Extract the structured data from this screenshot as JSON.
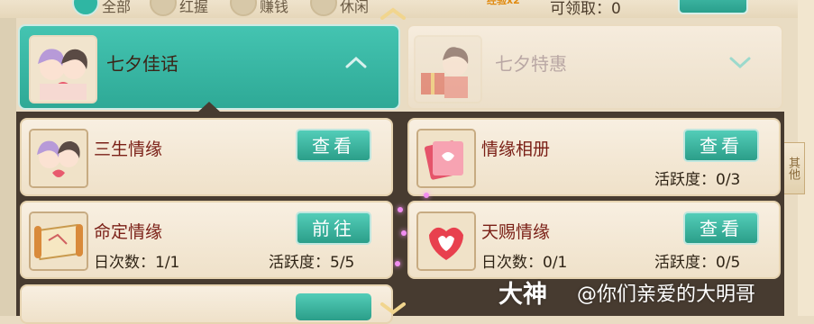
{
  "filter_bar": {
    "options": [
      {
        "label": "全部",
        "selected": true
      },
      {
        "label": "红握",
        "selected": false
      },
      {
        "label": "赚钱",
        "selected": false
      },
      {
        "label": "休闲",
        "selected": false
      }
    ],
    "exp_badge": "经验x2",
    "claim_text": "可领取：0"
  },
  "tabs": [
    {
      "label": "七夕佳话",
      "active": true,
      "icon": "couple-portrait-icon"
    },
    {
      "label": "七夕特惠",
      "active": false,
      "icon": "gift-girl-portrait-icon"
    }
  ],
  "side_tab": {
    "label": "其他"
  },
  "cards": [
    {
      "title": "三生情缘",
      "button": "查看",
      "icon": "couple-portrait-icon",
      "daily": "",
      "activity": ""
    },
    {
      "title": "情缘相册",
      "button": "查看",
      "icon": "photo-album-icon",
      "daily": "",
      "activity": "活跃度：0/3"
    },
    {
      "title": "命定情缘",
      "button": "前往",
      "icon": "scroll-map-icon",
      "daily": "日次数：1/1",
      "activity": "活跃度：5/5"
    },
    {
      "title": "天赐情缘",
      "button": "查看",
      "icon": "heart-puzzle-icon",
      "daily": "日次数：0/1",
      "activity": "活跃度：0/5"
    }
  ],
  "watermark": {
    "logo": "大神",
    "text": "@你们亲爱的大明哥"
  },
  "colors": {
    "accent": "#2fb6a3",
    "title_red": "#7a1f16",
    "panel_dark": "#473b30"
  }
}
